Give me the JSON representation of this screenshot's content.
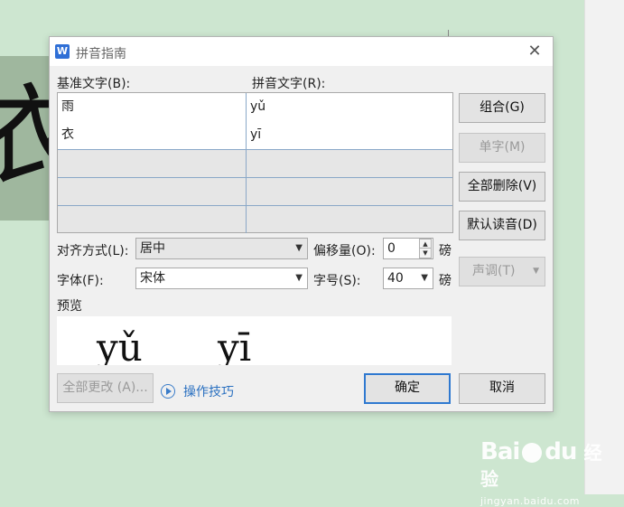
{
  "background": {
    "doc_char": "衣"
  },
  "dialog": {
    "title": "拼音指南",
    "app_icon": "W",
    "base_text_label": "基准文字(B):",
    "ruby_text_label": "拼音文字(R):",
    "rows": [
      {
        "base": "雨",
        "ruby": "yǔ"
      },
      {
        "base": "衣",
        "ruby": "yī"
      },
      {
        "base": "",
        "ruby": ""
      },
      {
        "base": "",
        "ruby": ""
      },
      {
        "base": "",
        "ruby": ""
      }
    ],
    "buttons": {
      "group": "组合(G)",
      "mono": "单字(M)",
      "clear_all": "全部删除(V)",
      "default_reading": "默认读音(D)",
      "tone": "声调(T)",
      "change_all": "全部更改 (A)...",
      "ok": "确定",
      "cancel": "取消"
    },
    "alignment": {
      "label": "对齐方式(L):",
      "value": "居中"
    },
    "offset": {
      "label": "偏移量(O):",
      "value": "0",
      "unit": "磅"
    },
    "font": {
      "label": "字体(F):",
      "value": "宋体"
    },
    "size": {
      "label": "字号(S):",
      "value": "40",
      "unit": "磅"
    },
    "preview": {
      "label": "预览",
      "syllables": [
        "yǔ",
        "yī"
      ]
    },
    "tips_link": "操作技巧"
  },
  "watermark": {
    "logo": "Bai",
    "logo_suffix": "du",
    "cn": "经验",
    "url": "jingyan.baidu.com"
  },
  "colors": {
    "accent": "#2f79d0",
    "link": "#2a70c0",
    "background": "#cde6d0"
  }
}
